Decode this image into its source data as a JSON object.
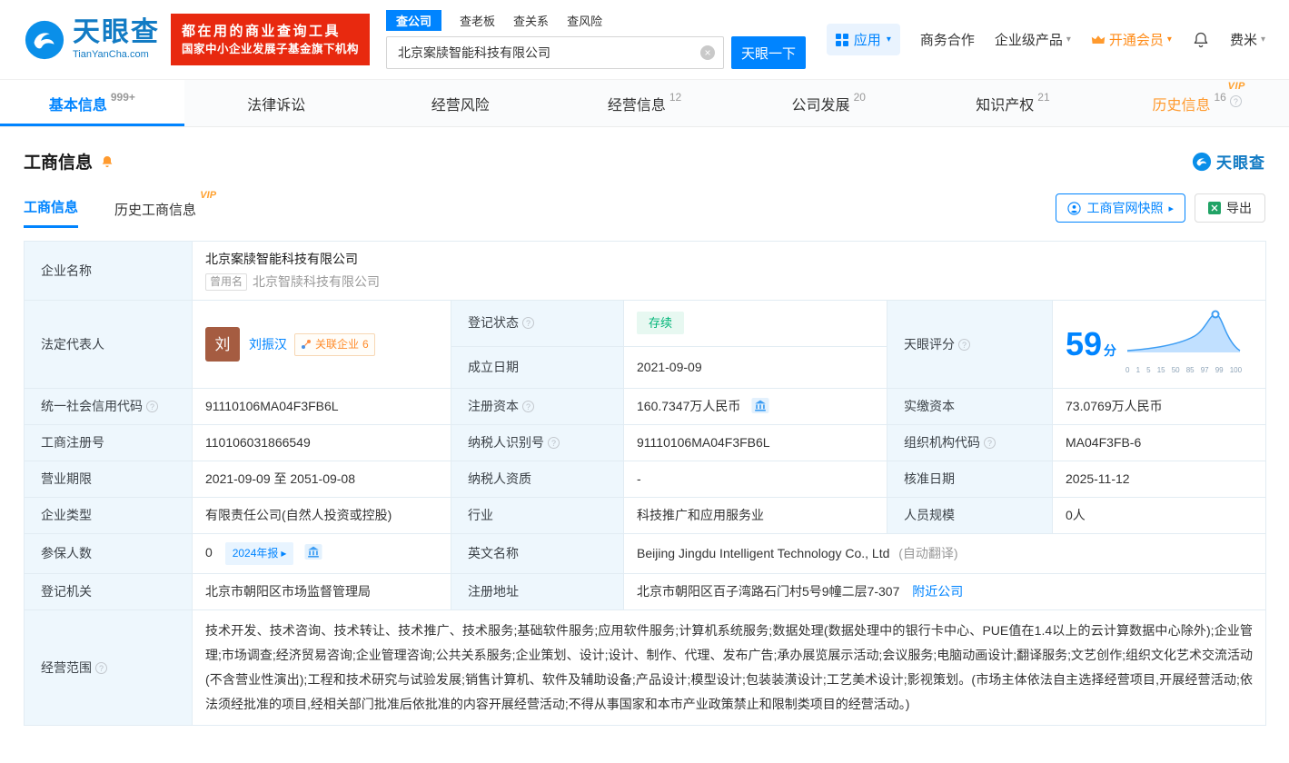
{
  "vip_label": "VIP",
  "icons": {
    "caret_down": "▾",
    "clear": "×",
    "question": "?",
    "arrow_right": "▸"
  },
  "colors": {
    "brand_blue": "#0084ff",
    "banner_red": "#e8290f",
    "vip_orange": "#ffa12f",
    "status_green": "#00b578",
    "link_blue": "#0084ff"
  },
  "header": {
    "brand": "天眼查",
    "brand_domain": "TianYanCha.com",
    "banner_line1": "都在用的商业查询工具",
    "banner_line2": "国家中小企业发展子基金旗下机构",
    "search_tabs": {
      "company": "查公司",
      "boss": "查老板",
      "relation": "查关系",
      "risk": "查风险"
    },
    "search_value": "北京案牍智能科技有限公司",
    "search_button": "天眼一下",
    "nav_apps": "应用",
    "nav_cooperation": "商务合作",
    "nav_enterprise": "企业级产品",
    "nav_vip": "开通会员",
    "nav_user": "费米"
  },
  "main_tabs": [
    {
      "label": "基本信息",
      "count": "999+"
    },
    {
      "label": "法律诉讼",
      "count": ""
    },
    {
      "label": "经营风险",
      "count": ""
    },
    {
      "label": "经营信息",
      "count": "12"
    },
    {
      "label": "公司发展",
      "count": "20"
    },
    {
      "label": "知识产权",
      "count": "21"
    },
    {
      "label": "历史信息",
      "count": "16"
    }
  ],
  "section": {
    "title": "工商信息",
    "subtab_current": "工商信息",
    "subtab_history": "历史工商信息",
    "snapshot_button": "工商官网快照",
    "export_button": "导出",
    "brand_small": "天眼查"
  },
  "company": {
    "name_label": "企业名称",
    "name": "北京案牍智能科技有限公司",
    "former_name_tag": "曾用名",
    "former_name": "北京智牍科技有限公司",
    "legal_rep_label": "法定代表人",
    "legal_rep_avatar": "刘",
    "legal_rep": "刘振汉",
    "related_label": "关联企业",
    "related_count": "6",
    "status_label": "登记状态",
    "status": "存续",
    "established_label": "成立日期",
    "established": "2021-09-09",
    "score_label": "天眼评分",
    "score": "59",
    "score_unit": "分",
    "score_axis": [
      "0",
      "1",
      "5",
      "15",
      "50",
      "85",
      "97",
      "99",
      "100"
    ],
    "uscc_label": "统一社会信用代码",
    "uscc": "91110106MA04F3FB6L",
    "reg_capital_label": "注册资本",
    "reg_capital": "160.7347万人民币",
    "paid_capital_label": "实缴资本",
    "paid_capital": "73.0769万人民币",
    "reg_no_label": "工商注册号",
    "reg_no": "110106031866549",
    "taxpayer_id_label": "纳税人识别号",
    "taxpayer_id": "91110106MA04F3FB6L",
    "org_code_label": "组织机构代码",
    "org_code": "MA04F3FB-6",
    "term_label": "营业期限",
    "term": "2021-09-09 至 2051-09-08",
    "taxpayer_quality_label": "纳税人资质",
    "taxpayer_quality": "-",
    "approval_date_label": "核准日期",
    "approval_date": "2025-11-12",
    "type_label": "企业类型",
    "type": "有限责任公司(自然人投资或控股)",
    "industry_label": "行业",
    "industry": "科技推广和应用服务业",
    "staff_label": "人员规模",
    "staff": "0人",
    "insured_label": "参保人数",
    "insured": "0",
    "annual_report_badge": "2024年报",
    "english_name_label": "英文名称",
    "english_name": "Beijing Jingdu Intelligent Technology Co., Ltd",
    "auto_translate": "(自动翻译)",
    "registry_label": "登记机关",
    "registry": "北京市朝阳区市场监督管理局",
    "address_label": "注册地址",
    "address": "北京市朝阳区百子湾路石门村5号9幢二层7-307",
    "nearby_link": "附近公司",
    "scope_label": "经营范围",
    "scope": "技术开发、技术咨询、技术转让、技术推广、技术服务;基础软件服务;应用软件服务;计算机系统服务;数据处理(数据处理中的银行卡中心、PUE值在1.4以上的云计算数据中心除外);企业管理;市场调查;经济贸易咨询;企业管理咨询;公共关系服务;企业策划、设计;设计、制作、代理、发布广告;承办展览展示活动;会议服务;电脑动画设计;翻译服务;文艺创作;组织文化艺术交流活动(不含营业性演出);工程和技术研究与试验发展;销售计算机、软件及辅助设备;产品设计;模型设计;包装装潢设计;工艺美术设计;影视策划。(市场主体依法自主选择经营项目,开展经营活动;依法须经批准的项目,经相关部门批准后依批准的内容开展经营活动;不得从事国家和本市产业政策禁止和限制类项目的经营活动。)"
  }
}
